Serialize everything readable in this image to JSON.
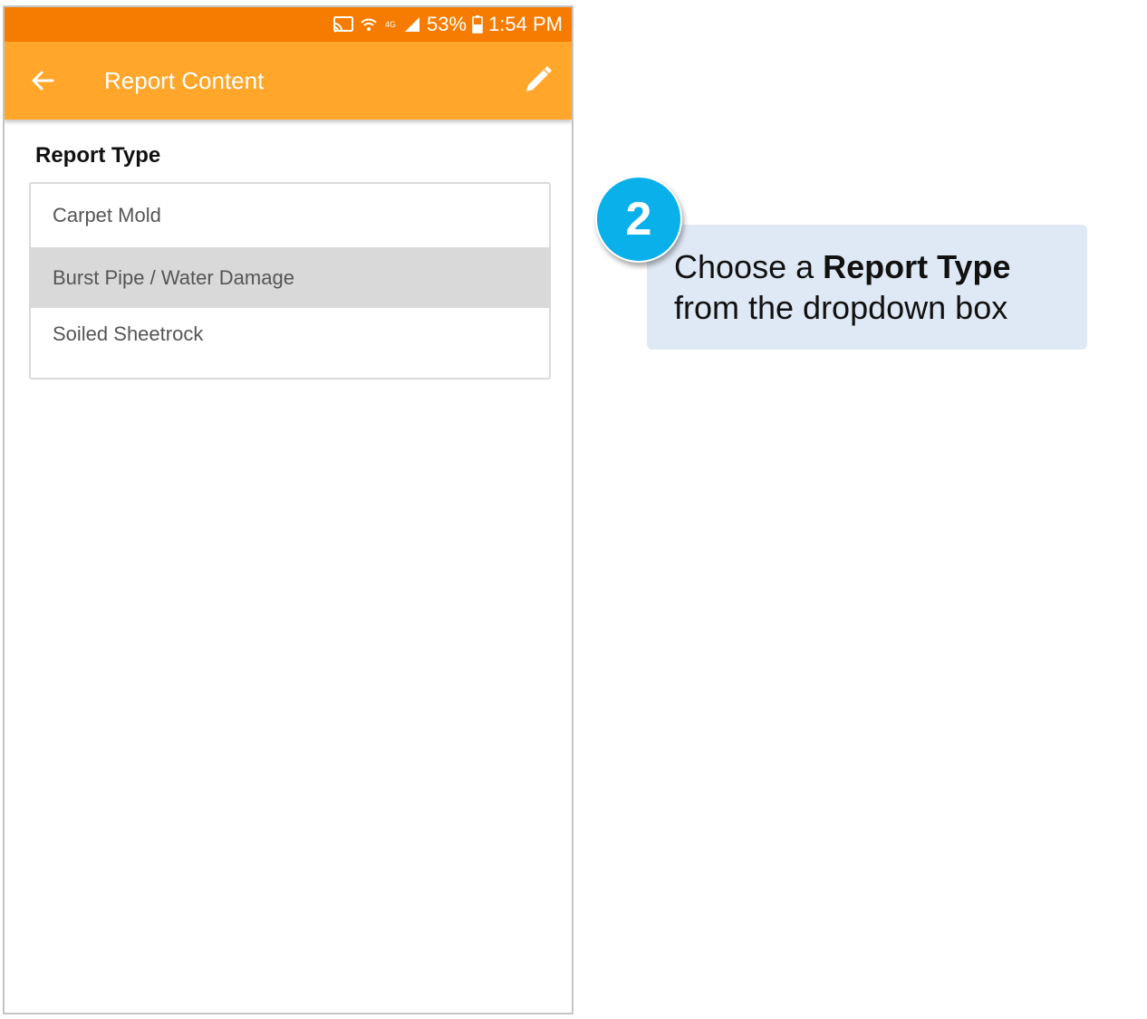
{
  "status_bar": {
    "network_label": "4G",
    "battery": "53%",
    "time": "1:54 PM",
    "icons": [
      "cast-icon",
      "wifi-icon",
      "signal-icon",
      "battery-icon"
    ]
  },
  "app_bar": {
    "title": "Report Content",
    "color": "#ffa62b",
    "status_color": "#f57c00",
    "icons": [
      "back-arrow-icon",
      "pencil-icon"
    ]
  },
  "form": {
    "report_type_label": "Report Type",
    "options": [
      {
        "label": "Carpet Mold",
        "highlighted": false
      },
      {
        "label": "Burst Pipe / Water Damage",
        "highlighted": true
      },
      {
        "label": "Soiled Sheetrock",
        "highlighted": false
      }
    ]
  },
  "callout": {
    "step_number": "2",
    "badge_color": "#0ab0ea",
    "text_prefix": "Choose a ",
    "text_bold": "Report Type",
    "text_line2": "from the dropdown box"
  }
}
